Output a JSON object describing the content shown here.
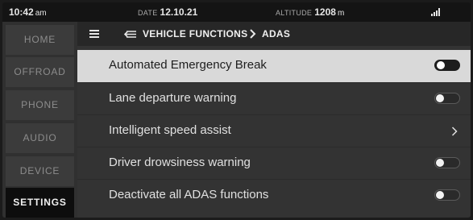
{
  "status_bar": {
    "time": "10:42",
    "time_suffix": "am",
    "date_label": "DATE",
    "date_value": "12.10.21",
    "altitude_label": "ALTITUDE",
    "altitude_value": "1208",
    "altitude_unit": "m",
    "signal_icon": "signal-bars-icon"
  },
  "sidebar": {
    "items": [
      {
        "label": "HOME",
        "active": false
      },
      {
        "label": "OFFROAD",
        "active": false
      },
      {
        "label": "PHONE",
        "active": false
      },
      {
        "label": "AUDIO",
        "active": false
      },
      {
        "label": "DEVICE",
        "active": false
      },
      {
        "label": "SETTINGS",
        "active": true
      }
    ]
  },
  "header": {
    "menu_icon": "hamburger-menu-icon",
    "back_icon": "return-arrow-icon",
    "breadcrumb_parent": "VEHICLE FUNCTIONS",
    "breadcrumb_separator_icon": "chevron-right-icon",
    "breadcrumb_current": "ADAS"
  },
  "settings": {
    "rows": [
      {
        "label": "Automated Emergency Break",
        "control": "toggle",
        "enabled": false,
        "selected": true
      },
      {
        "label": "Lane departure warning",
        "control": "toggle",
        "enabled": false,
        "selected": false
      },
      {
        "label": "Intelligent speed assist",
        "control": "chevron",
        "selected": false
      },
      {
        "label": "Driver drowsiness warning",
        "control": "toggle",
        "enabled": false,
        "selected": false
      },
      {
        "label": "Deactivate all ADAS functions",
        "control": "toggle",
        "enabled": false,
        "selected": false
      }
    ]
  },
  "colors": {
    "status_bar_bg": "#141414",
    "sidebar_bg": "#303030",
    "sidebar_item_bg": "#3b3b3b",
    "sidebar_active_bg": "#0d0d0d",
    "list_bg": "#333333",
    "selected_row_bg": "#d9d9d9",
    "header_bg": "#272727"
  }
}
